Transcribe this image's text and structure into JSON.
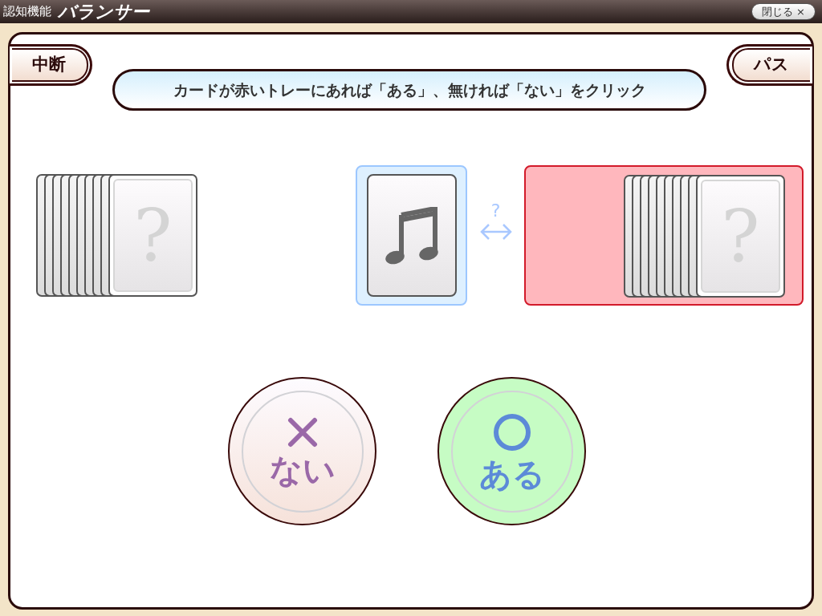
{
  "title_bar": {
    "app_name": "認知機能",
    "logo": "バランサー",
    "close_button": "閉じる ×"
  },
  "buttons": {
    "pause": "中断",
    "pass": "パス"
  },
  "instruction": "カードが赤いトレーにあれば「ある」、無ければ「ない」をクリック",
  "deck": [
    {
      "kind": "edge"
    },
    {
      "kind": "edge"
    },
    {
      "kind": "edge"
    },
    {
      "kind": "edge"
    },
    {
      "kind": "edge"
    },
    {
      "kind": "edge"
    },
    {
      "kind": "edge"
    },
    {
      "kind": "edge"
    },
    {
      "kind": "edge"
    },
    {
      "kind": "face",
      "mark": "?"
    }
  ],
  "current_card": {
    "kind": "music-note"
  },
  "compare_mark": "?",
  "red_tray": [
    {
      "kind": "edge"
    },
    {
      "kind": "edge"
    },
    {
      "kind": "edge"
    },
    {
      "kind": "edge"
    },
    {
      "kind": "edge"
    },
    {
      "kind": "edge"
    },
    {
      "kind": "edge"
    },
    {
      "kind": "edge"
    },
    {
      "kind": "edge"
    },
    {
      "kind": "face",
      "mark": "?"
    }
  ],
  "answers": [
    {
      "kind": "no",
      "label": "ない"
    },
    {
      "kind": "yes",
      "label": "ある"
    }
  ]
}
